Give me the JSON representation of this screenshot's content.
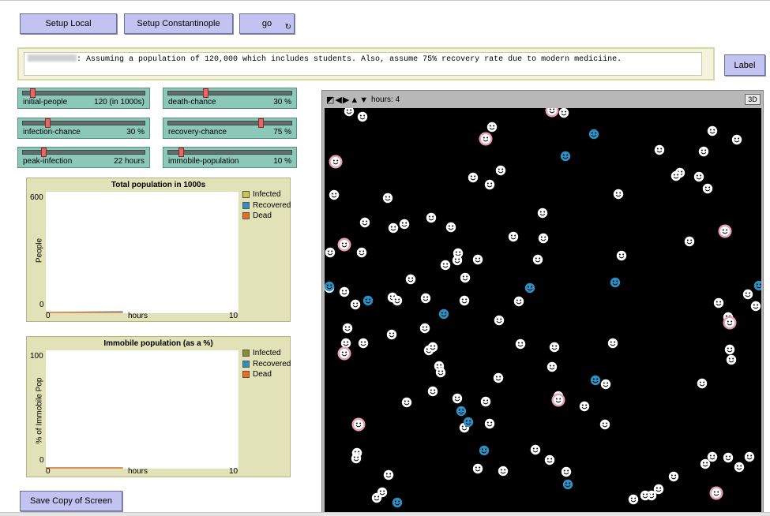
{
  "buttons": {
    "setup_local": "Setup Local",
    "setup_constantinople": "Setup Constantinople",
    "go": "go",
    "go_forever_icon": "forever-arrows-icon",
    "label": "Label",
    "save": "Save Copy of Screen"
  },
  "note": {
    "text": ": Assuming a population of 120,000 which includes students. Also, assume 75% recovery rate due to modern mediciine."
  },
  "sliders": [
    {
      "name": "initial-people",
      "value": "120 (in 1000s)",
      "fraction": 0.08
    },
    {
      "name": "death-chance",
      "value": "30 %",
      "fraction": 0.3
    },
    {
      "name": "infection-chance",
      "value": "30 %",
      "fraction": 0.2
    },
    {
      "name": "recovery-chance",
      "value": "75 %",
      "fraction": 0.75
    },
    {
      "name": "peak-infection",
      "value": "22 hours",
      "fraction": 0.17
    },
    {
      "name": "immobile-population",
      "value": "10 %",
      "fraction": 0.1
    }
  ],
  "plot1": {
    "title": "Total population in 1000s",
    "ylabel": "People",
    "xlabel": "hours",
    "ymax": "600",
    "ymin": "0",
    "xmin": "0",
    "xmax": "10",
    "legend": [
      "Infected",
      "Recovered",
      "Dead"
    ]
  },
  "plot2": {
    "title": "Immobile population (as a %)",
    "ylabel": "% of Immobile Pop",
    "xlabel": "hours",
    "ymax": "100",
    "ymin": "0",
    "xmin": "0",
    "xmax": "10",
    "legend": [
      "Infected",
      "Recovered",
      "Dead"
    ]
  },
  "colors": {
    "infected": "#cfcf2a",
    "recovered": "#2f8fc2",
    "dead": "#f26a1b",
    "plot1_infected": "#c7c74a",
    "plot2_infected": "#8d8d2a",
    "infected_ring": "#e8a0b4"
  },
  "chart_data": [
    {
      "type": "line",
      "title": "Total population in 1000s",
      "xlabel": "hours",
      "ylabel": "People",
      "xlim": [
        0,
        10
      ],
      "ylim": [
        0,
        600
      ],
      "legend": "right",
      "series": [
        {
          "name": "Infected",
          "x": [
            0,
            4
          ],
          "y": [
            0,
            0
          ]
        },
        {
          "name": "Recovered",
          "x": [
            0,
            4
          ],
          "y": [
            0,
            4
          ]
        },
        {
          "name": "Dead",
          "x": [
            0,
            4
          ],
          "y": [
            0,
            0
          ]
        }
      ]
    },
    {
      "type": "line",
      "title": "Immobile population (as a %)",
      "xlabel": "hours",
      "ylabel": "% of Immobile Pop",
      "xlim": [
        0,
        10
      ],
      "ylim": [
        0,
        100
      ],
      "legend": "right",
      "series": [
        {
          "name": "Infected",
          "x": [
            0,
            4
          ],
          "y": [
            0,
            0
          ]
        },
        {
          "name": "Recovered",
          "x": [
            0,
            4
          ],
          "y": [
            0,
            0
          ]
        },
        {
          "name": "Dead",
          "x": [
            0,
            4
          ],
          "y": [
            0,
            0
          ]
        }
      ]
    }
  ],
  "view": {
    "ticks": "hours: 4",
    "btn3d": "3D",
    "icons": [
      "resize-icon",
      "pan-icon",
      "zoom-icon"
    ]
  },
  "agents": {
    "healthy": [
      [
        441,
        140
      ],
      [
        458,
        147
      ],
      [
        622,
        160
      ],
      [
        713,
        142
      ],
      [
        901,
        165
      ],
      [
        932,
        176
      ],
      [
        834,
        189
      ],
      [
        890,
        191
      ],
      [
        633,
        215
      ],
      [
        598,
        224
      ],
      [
        619,
        233
      ],
      [
        860,
        218
      ],
      [
        855,
        222
      ],
      [
        884,
        223
      ],
      [
        422,
        246
      ],
      [
        490,
        250
      ],
      [
        782,
        245
      ],
      [
        895,
        238
      ],
      [
        686,
        269
      ],
      [
        461,
        281
      ],
      [
        497,
        288
      ],
      [
        511,
        283
      ],
      [
        545,
        275
      ],
      [
        570,
        287
      ],
      [
        649,
        299
      ],
      [
        687,
        301
      ],
      [
        417,
        319
      ],
      [
        457,
        319
      ],
      [
        579,
        320
      ],
      [
        578,
        329
      ],
      [
        563,
        335
      ],
      [
        604,
        328
      ],
      [
        680,
        328
      ],
      [
        786,
        323
      ],
      [
        872,
        305
      ],
      [
        519,
        353
      ],
      [
        588,
        351
      ],
      [
        435,
        369
      ],
      [
        416,
        364
      ],
      [
        496,
        376
      ],
      [
        502,
        380
      ],
      [
        538,
        377
      ],
      [
        587,
        380
      ],
      [
        656,
        381
      ],
      [
        909,
        383
      ],
      [
        946,
        372
      ],
      [
        956,
        387
      ],
      [
        449,
        385
      ],
      [
        921,
        401
      ],
      [
        439,
        415
      ],
      [
        537,
        415
      ],
      [
        631,
        405
      ],
      [
        437,
        434
      ],
      [
        459,
        434
      ],
      [
        495,
        423
      ],
      [
        542,
        443
      ],
      [
        547,
        439
      ],
      [
        658,
        435
      ],
      [
        701,
        439
      ],
      [
        775,
        434
      ],
      [
        923,
        442
      ],
      [
        925,
        455
      ],
      [
        555,
        463
      ],
      [
        557,
        471
      ],
      [
        698,
        464
      ],
      [
        630,
        478
      ],
      [
        766,
        486
      ],
      [
        888,
        485
      ],
      [
        547,
        495
      ],
      [
        578,
        504
      ],
      [
        514,
        509
      ],
      [
        614,
        508
      ],
      [
        706,
        501
      ],
      [
        739,
        514
      ],
      [
        587,
        541
      ],
      [
        619,
        536
      ],
      [
        765,
        537
      ],
      [
        451,
        573
      ],
      [
        450,
        580
      ],
      [
        677,
        569
      ],
      [
        695,
        582
      ],
      [
        901,
        578
      ],
      [
        921,
        579
      ],
      [
        948,
        578
      ],
      [
        935,
        591
      ],
      [
        604,
        593
      ],
      [
        636,
        596
      ],
      [
        716,
        597
      ],
      [
        491,
        601
      ],
      [
        852,
        603
      ],
      [
        483,
        623
      ],
      [
        476,
        630
      ],
      [
        833,
        619
      ],
      [
        824,
        627
      ],
      [
        816,
        627
      ],
      [
        801,
        632
      ],
      [
        892,
        587
      ]
    ],
    "infected": [
      [
        698,
        139
      ],
      [
        614,
        175
      ],
      [
        424,
        204
      ],
      [
        917,
        292
      ],
      [
        435,
        309
      ],
      [
        923,
        408
      ],
      [
        435,
        447
      ],
      [
        706,
        506
      ],
      [
        453,
        537
      ],
      [
        906,
        624
      ]
    ],
    "recovered": [
      [
        751,
        169
      ],
      [
        715,
        197
      ],
      [
        778,
        357
      ],
      [
        670,
        364
      ],
      [
        465,
        380
      ],
      [
        561,
        397
      ],
      [
        753,
        481
      ],
      [
        583,
        520
      ],
      [
        592,
        534
      ],
      [
        612,
        570
      ],
      [
        718,
        613
      ],
      [
        502,
        636
      ],
      [
        416,
        362
      ],
      [
        960,
        361
      ]
    ]
  }
}
